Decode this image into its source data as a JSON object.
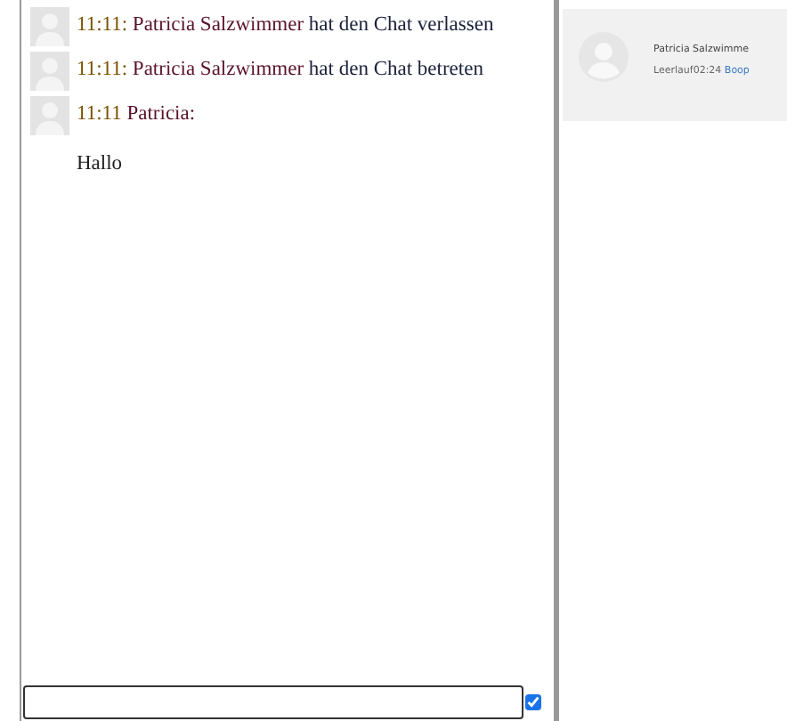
{
  "messages": [
    {
      "kind": "event",
      "time": "11:11:",
      "name": "Patricia Salzwimmer",
      "text": "hat den Chat verlassen"
    },
    {
      "kind": "event",
      "time": "11:11:",
      "name": "Patricia Salzwimmer",
      "text": "hat den Chat betreten"
    },
    {
      "kind": "post",
      "time": "11:11",
      "name": "Patricia:",
      "text": "Hallo"
    }
  ],
  "input": {
    "checked": true
  },
  "users": [
    {
      "name": "Patricia Salzwimme",
      "status": "Leerlauf02:24",
      "action": "Boop"
    }
  ]
}
